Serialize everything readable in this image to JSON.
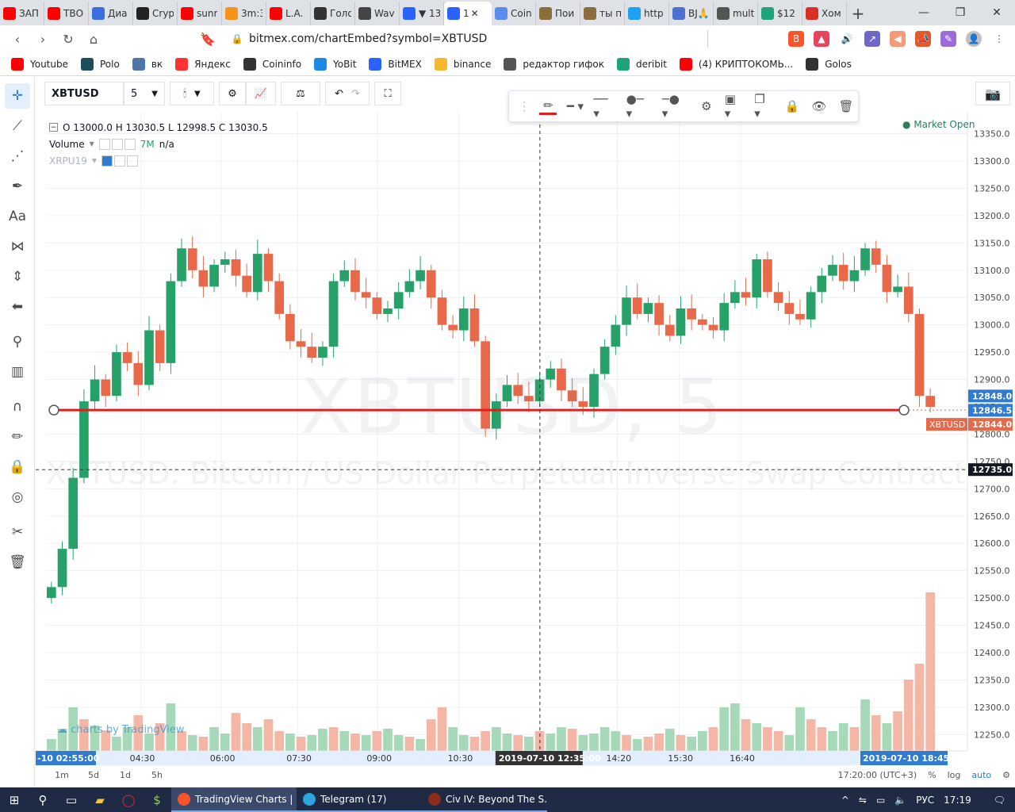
{
  "browser": {
    "tabs": [
      {
        "title": "ЗАП",
        "color": "#ff0000"
      },
      {
        "title": "ТВО",
        "color": "#ff0000"
      },
      {
        "title": "Диа",
        "color": "#3b6ee0"
      },
      {
        "title": "Cryp",
        "color": "#222222"
      },
      {
        "title": "sunr",
        "color": "#ff0000"
      },
      {
        "title": "3m:3",
        "color": "#f7931a"
      },
      {
        "title": "L.A.",
        "color": "#ff0000"
      },
      {
        "title": "Голо",
        "color": "#333333"
      },
      {
        "title": "Wav",
        "color": "#444444"
      },
      {
        "title": "▼ 13",
        "color": "#2962ff"
      },
      {
        "title": "1",
        "color": "#2962ff",
        "active": true
      },
      {
        "title": "Coin",
        "color": "#5a8dee"
      },
      {
        "title": "Пои",
        "color": "#8a6d3b"
      },
      {
        "title": "ты п",
        "color": "#8a6d3b"
      },
      {
        "title": "http",
        "color": "#1da1f2"
      },
      {
        "title": "BJ🙏",
        "color": "#4d6fd1"
      },
      {
        "title": "mult",
        "color": "#555555"
      },
      {
        "title": "$12",
        "color": "#1fa37a"
      },
      {
        "title": "Хом",
        "color": "#d93025"
      }
    ],
    "url": "bitmex.com/chartEmbed?symbol=XBTUSD",
    "bookmarks": [
      {
        "label": "Youtube",
        "color": "#ff0000"
      },
      {
        "label": "Polo",
        "color": "#1c4d5a"
      },
      {
        "label": "вк",
        "color": "#4a76a8"
      },
      {
        "label": "Яндекс",
        "color": "#ff3333"
      },
      {
        "label": "Coininfo",
        "color": "#333333"
      },
      {
        "label": "YoBit",
        "color": "#1e88e5"
      },
      {
        "label": "BitMEX",
        "color": "#2962ff"
      },
      {
        "label": "binance",
        "color": "#f3ba2f"
      },
      {
        "label": "редактор гифок",
        "color": "#555555"
      },
      {
        "label": "deribit",
        "color": "#1fa37a"
      },
      {
        "label": "(4) КРИПТОКОМЬ...",
        "color": "#ff0000"
      },
      {
        "label": "Golos",
        "color": "#333333"
      }
    ]
  },
  "toolbar": {
    "symbol": "XBTUSD",
    "interval": "5"
  },
  "legend": {
    "ohlc": "O 13000.0 H 13030.5 L 12998.5 C 13030.5",
    "volume_label": "Volume",
    "volume_value": "7M",
    "volume_na": "n/a",
    "compare_symbol": "XRPU19",
    "market_status": "Market Open"
  },
  "watermark": {
    "main": "XBTUSD, 5",
    "sub": "XBTUSD: Bitcoin / US Dollar Perpetual Inverse Swap Contract"
  },
  "branding": "charts by TradingView",
  "chart_data": {
    "type": "candlestick",
    "symbol": "XBTUSD",
    "interval": "5",
    "y_ticks": [
      13350,
      13300,
      13250,
      13200,
      13150,
      13100,
      13050,
      13000,
      12950,
      12900,
      12850,
      12800,
      12750,
      12700,
      12650,
      12600,
      12550,
      12500,
      12450,
      12400,
      12350,
      12300,
      12250
    ],
    "ylim": [
      12220,
      13390
    ],
    "x_ticks": [
      "04:30",
      "06:00",
      "07:30",
      "09:00",
      "10:30",
      "12:35:00",
      "14:20",
      "15:30",
      "16:40"
    ],
    "x_tick_fracs": [
      0.103,
      0.19,
      0.273,
      0.36,
      0.448,
      0.536,
      0.62,
      0.687,
      0.754
    ],
    "crosshair_label": "2019-07-10 12:35:00",
    "left_time_label": "-10 02:55:00",
    "right_time_label": "2019-07-10 18:45:00",
    "price_labels": [
      {
        "text": "12848.0",
        "value": 12848,
        "color": "#2e7bcf"
      },
      {
        "text": "12846.5",
        "value": 12846.5,
        "color": "#2e7bcf"
      },
      {
        "text": "12844.0",
        "value": 12844,
        "color": "#e8694a"
      },
      {
        "text": "12735.0",
        "value": 12735,
        "color": "#131722"
      }
    ],
    "symbol_tag": "XBTUSD",
    "horizontal_line": {
      "value": 12844,
      "color": "#e01e1e"
    },
    "crosshair_price": 12735,
    "close_series": [
      12520,
      12590,
      12720,
      12860,
      12900,
      12870,
      12950,
      12930,
      12890,
      12990,
      12930,
      13080,
      13140,
      13100,
      13070,
      13110,
      13120,
      13090,
      13060,
      13130,
      13080,
      13020,
      12970,
      12960,
      12940,
      12960,
      13080,
      13100,
      13060,
      13050,
      13020,
      13030,
      13060,
      13080,
      13100,
      13050,
      13000,
      12990,
      13030,
      12970,
      12810,
      12860,
      12890,
      12870,
      12860,
      12900,
      12920,
      12880,
      12860,
      12850,
      12910,
      12960,
      13000,
      13050,
      13020,
      13040,
      13000,
      12980,
      13030,
      13010,
      13000,
      12990,
      13040,
      13060,
      13050,
      13120,
      13060,
      13040,
      13020,
      13010,
      13060,
      13090,
      13110,
      13080,
      13100,
      13140,
      13110,
      13060,
      13070,
      13020,
      12870,
      12850
    ],
    "volume_series": [
      15,
      28,
      55,
      40,
      32,
      26,
      18,
      30,
      45,
      22,
      35,
      60,
      25,
      20,
      18,
      30,
      22,
      48,
      35,
      30,
      40,
      25,
      22,
      18,
      20,
      28,
      30,
      25,
      22,
      20,
      25,
      28,
      20,
      18,
      15,
      40,
      55,
      30,
      20,
      18,
      25,
      30,
      22,
      20,
      18,
      25,
      22,
      30,
      28,
      20,
      22,
      30,
      25,
      20,
      15,
      18,
      22,
      28,
      20,
      18,
      25,
      30,
      55,
      60,
      40,
      35,
      30,
      25,
      20,
      55,
      40,
      30,
      25,
      35,
      30,
      65,
      45,
      35,
      50,
      90,
      110,
      200
    ],
    "volume_directions": [
      1,
      1,
      1,
      0,
      1,
      0,
      1,
      1,
      0,
      1,
      0,
      1,
      0,
      1,
      0,
      1,
      1,
      0,
      0,
      1,
      0,
      0,
      1,
      0,
      1,
      1,
      0,
      1,
      0,
      1,
      0,
      1,
      1,
      0,
      1,
      0,
      0,
      1,
      1,
      0,
      0,
      1,
      1,
      0,
      1,
      0,
      1,
      1,
      0,
      1,
      1,
      1,
      1,
      0,
      1,
      0,
      0,
      1,
      0,
      1,
      1,
      0,
      1,
      1,
      0,
      1,
      0,
      0,
      1,
      1,
      0,
      0,
      1,
      1,
      0,
      1,
      0,
      1,
      0,
      0,
      0,
      0
    ]
  },
  "bottom": {
    "timeframes": [
      "1m",
      "5d",
      "1d",
      "5h"
    ],
    "clock": "17:20:00 (UTC+3)",
    "percent": "%",
    "log": "log",
    "auto": "auto"
  },
  "taskbar": {
    "apps": [
      {
        "label": "TradingView Charts | ...",
        "color": "#fb542b",
        "active": true
      },
      {
        "label": "Telegram (17)",
        "color": "#2ca5e0"
      },
      {
        "label": "Civ IV: Beyond The S...",
        "color": "#8b2c1c"
      }
    ],
    "lang": "РУС",
    "time": "17:19"
  },
  "colors": {
    "up": "#26a269",
    "down": "#e8694a",
    "volume_up": "#a5d9b7",
    "volume_down": "#f4b7a6",
    "line": "#e01e1e"
  }
}
